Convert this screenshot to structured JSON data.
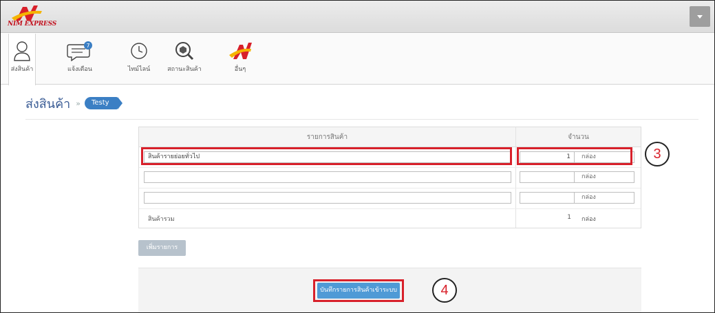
{
  "header": {
    "logo_text": "NIM EXPRESS",
    "brand_colors": {
      "red": "#d8202a",
      "yellow": "#f5b400"
    }
  },
  "nav": {
    "items": [
      {
        "label": "ส่งสินค้า",
        "icon": "user-icon"
      },
      {
        "label": "แจ้งเตือน",
        "icon": "chat-bubble-icon",
        "badge": "7"
      },
      {
        "label": "ไทม์ไลน์",
        "icon": "clock-icon"
      },
      {
        "label": "สถานะสินค้า",
        "icon": "search-box-icon"
      },
      {
        "label": "อื่นๆ",
        "icon": "nim-logo-icon"
      }
    ]
  },
  "breadcrumb": {
    "title": "ส่งสินค้า",
    "separator": "»",
    "tag": "Testy"
  },
  "table": {
    "headers": {
      "items": "รายการสินค้า",
      "qty": "จำนวน"
    },
    "rows": [
      {
        "item": "สินค้ารายย่อยทั่วไป",
        "qty": "1",
        "unit": "กล่อง"
      },
      {
        "item": "",
        "qty": "",
        "unit": "กล่อง"
      },
      {
        "item": "",
        "qty": "",
        "unit": "กล่อง"
      }
    ],
    "total": {
      "label": "สินค้ารวม",
      "qty": "1",
      "unit": "กล่อง"
    }
  },
  "actions": {
    "add_row": "เพิ่มรายการ",
    "save": "บันทึกรายการสินค้าเข้าระบบ"
  },
  "callouts": {
    "step3": "3",
    "step4": "4"
  }
}
